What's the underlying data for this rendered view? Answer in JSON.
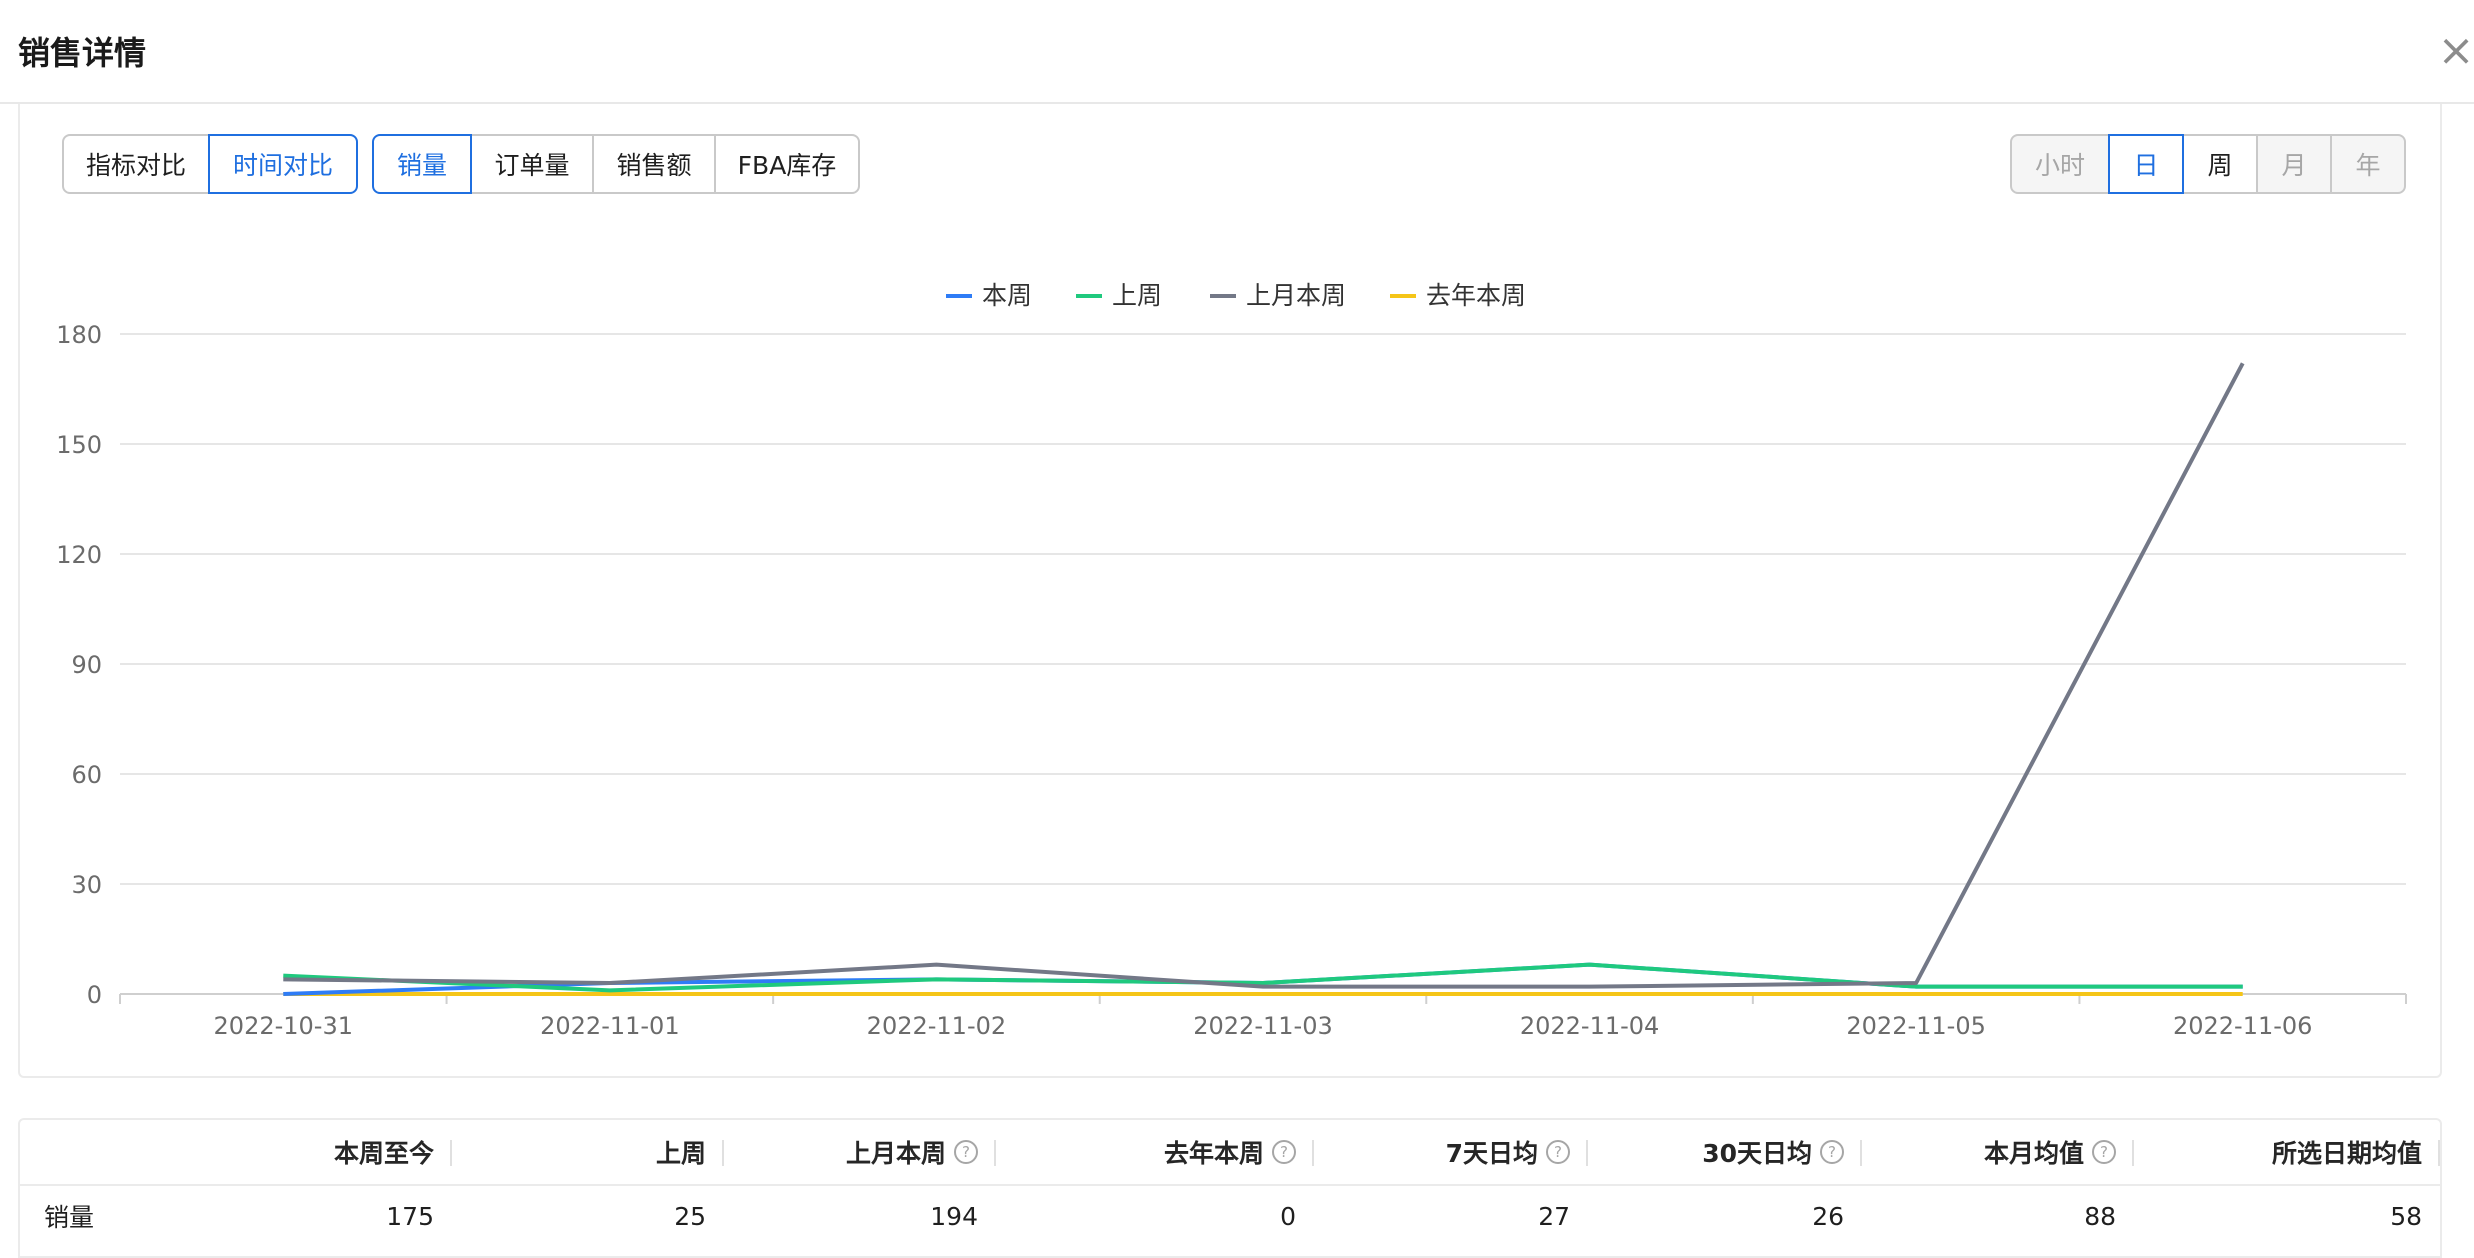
{
  "dialog": {
    "title": "销售详情",
    "close_icon": "close-icon"
  },
  "compare_toggle": {
    "items": [
      "指标对比",
      "时间对比"
    ],
    "active": 1
  },
  "metric_tabs": {
    "items": [
      "销量",
      "订单量",
      "销售额",
      "FBA库存"
    ],
    "active": 0
  },
  "granularity_tabs": {
    "items": [
      "小时",
      "日",
      "周",
      "月",
      "年"
    ],
    "active": 1,
    "disabled": [
      0,
      3,
      4
    ]
  },
  "chart_data": {
    "type": "line",
    "categories": [
      "2022-10-31",
      "2022-11-01",
      "2022-11-02",
      "2022-11-03",
      "2022-11-04",
      "2022-11-05",
      "2022-11-06"
    ],
    "series": [
      {
        "name": "本周",
        "color": "#2e7cf6",
        "values": [
          0,
          3,
          4,
          3,
          8,
          2,
          2
        ]
      },
      {
        "name": "上周",
        "color": "#1fc97e",
        "values": [
          5,
          1,
          4,
          3,
          8,
          2,
          2
        ]
      },
      {
        "name": "上月本周",
        "color": "#737887",
        "values": [
          4,
          3,
          8,
          2,
          2,
          3,
          172
        ]
      },
      {
        "name": "去年本周",
        "color": "#f5c518",
        "values": [
          0,
          0,
          0,
          0,
          0,
          0,
          0
        ]
      }
    ],
    "yticks": [
      0,
      30,
      60,
      90,
      120,
      150,
      180
    ],
    "ylim": [
      0,
      180
    ],
    "grid": true,
    "legend": "top-center"
  },
  "table": {
    "headers": [
      "本周至今",
      "上周",
      "上月本周",
      "去年本周",
      "7天日均",
      "30天日均",
      "本月均值",
      "所选日期均值"
    ],
    "help_icons": [
      false,
      false,
      true,
      true,
      true,
      true,
      true,
      false
    ],
    "row": {
      "label": "销量",
      "values": [
        "175",
        "25",
        "194",
        "0",
        "27",
        "26",
        "88",
        "58"
      ]
    }
  }
}
